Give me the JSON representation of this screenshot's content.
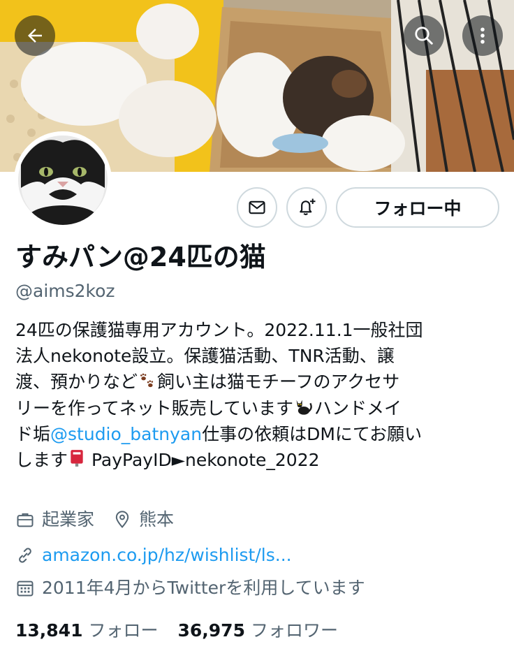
{
  "header": {
    "back_icon": "arrow-left-icon",
    "search_icon": "search-icon",
    "more_icon": "more-vertical-icon"
  },
  "profile": {
    "display_name": "すみパン@24匹の猫",
    "handle": "@aims2koz",
    "follow_button_label": "フォロー中",
    "bio": {
      "line1": "24匹の保護猫専用アカウント。2022.11.1一般社団",
      "line2": "法人nekonote設立。保護猫活動、TNR活動、譲",
      "line3a": "渡、預かりなど",
      "line3b": "飼い主は猫モチーフのアクセサ",
      "line4a": "リーを作ってネット販売しています",
      "line4b": "ハンドメイ",
      "line5a": "ド垢",
      "line5_mention": "@studio_batnyan",
      "line5b": "仕事の依頼はDMにてお願い",
      "line6a": "します",
      "line6b": "PayPayID",
      "line6c": "►",
      "line6d": "nekonote_2022"
    },
    "profession": "起業家",
    "location": "熊本",
    "website": "amazon.co.jp/hz/wishlist/ls...",
    "joined": "2011年4月からTwitterを利用しています",
    "following_count": "13,841",
    "following_label": "フォロー",
    "followers_count": "36,975",
    "followers_label": "フォロワー"
  },
  "colors": {
    "text": "#0f1419",
    "secondary": "#536471",
    "link": "#1d9bf0",
    "border": "#cfd9de"
  }
}
